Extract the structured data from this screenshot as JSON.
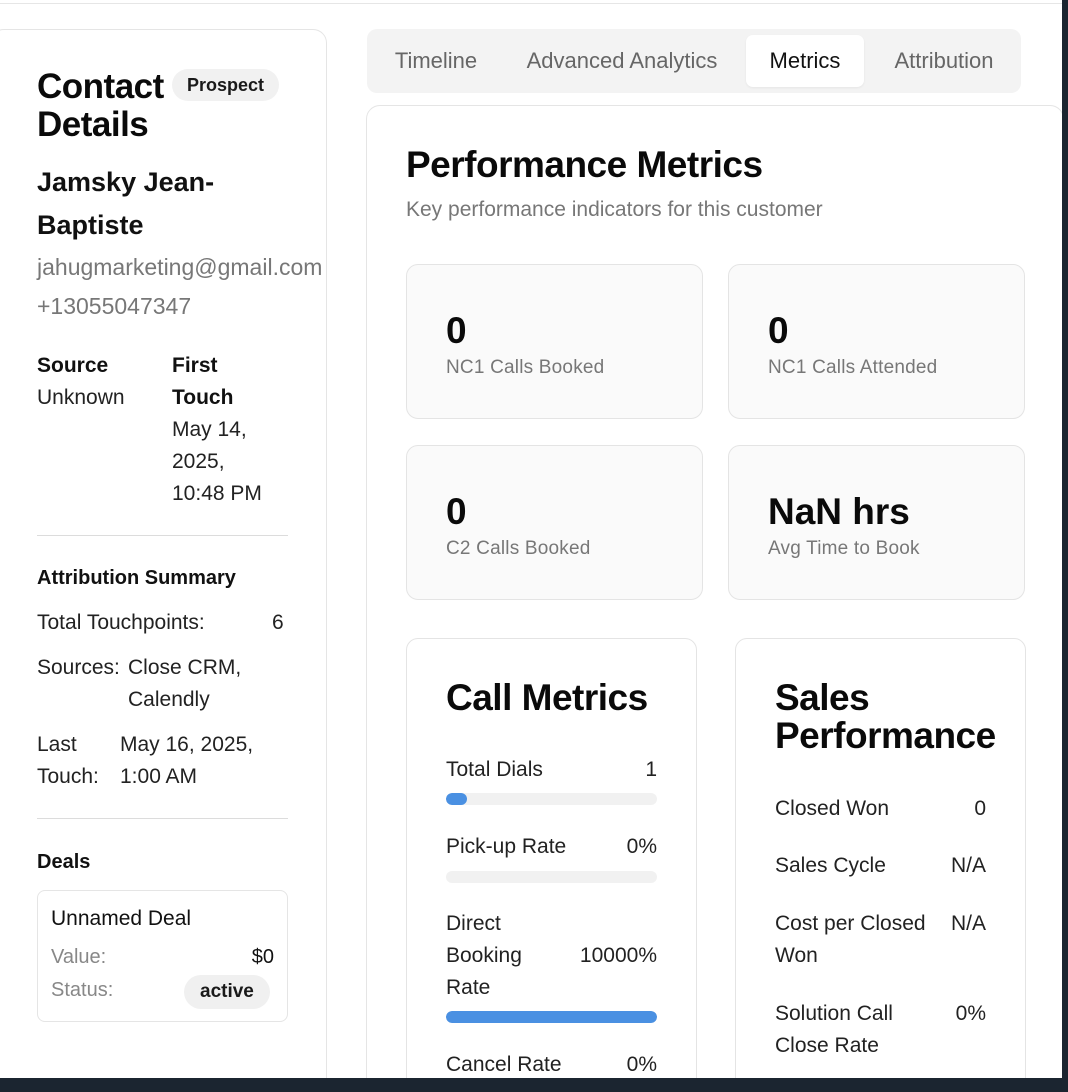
{
  "contact": {
    "title": "Contact Details",
    "badge": "Prospect",
    "name": "Jamsky Jean-Baptiste",
    "email": "jahugmarketing@gmail.com",
    "phone": "+13055047347",
    "source_label": "Source",
    "source_value": "Unknown",
    "first_touch_label": "First Touch",
    "first_touch_value": "May 14, 2025, 10:48 PM"
  },
  "attribution": {
    "heading": "Attribution Summary",
    "total_label": "Total Touchpoints:",
    "total_value": "6",
    "sources_label": "Sources:",
    "sources_value": "Close CRM, Calendly",
    "last_touch_label": "Last Touch:",
    "last_touch_value": "May 16, 2025, 1:00 AM"
  },
  "deals": {
    "heading": "Deals",
    "items": [
      {
        "name": "Unnamed Deal",
        "value_label": "Value:",
        "value": "$0",
        "status_label": "Status:",
        "status": "active"
      }
    ]
  },
  "tabs": [
    {
      "label": "Timeline",
      "active": false
    },
    {
      "label": "Advanced Analytics",
      "active": false
    },
    {
      "label": "Metrics",
      "active": true
    },
    {
      "label": "Attribution",
      "active": false
    }
  ],
  "performance": {
    "title": "Performance Metrics",
    "subtitle": "Key performance indicators for this customer",
    "kpis": [
      {
        "value": "0",
        "label": "NC1 Calls Booked"
      },
      {
        "value": "0",
        "label": "NC1 Calls Attended"
      },
      {
        "value": "0",
        "label": "C2 Calls Booked"
      },
      {
        "value": "NaN hrs",
        "label": "Avg Time to Book"
      }
    ]
  },
  "call_metrics": {
    "title": "Call Metrics",
    "items": [
      {
        "label": "Total Dials",
        "value": "1",
        "fill": 0.1
      },
      {
        "label": "Pick-up Rate",
        "value": "0%",
        "fill": 0
      },
      {
        "label": "Direct Booking Rate",
        "value": "10000%",
        "fill": 1
      },
      {
        "label": "Cancel Rate",
        "value": "0%",
        "fill": 0
      }
    ]
  },
  "sales_performance": {
    "title": "Sales Performance",
    "items": [
      {
        "label": "Closed Won",
        "value": "0"
      },
      {
        "label": "Sales Cycle",
        "value": "N/A"
      },
      {
        "label": "Cost per Closed Won",
        "value": "N/A"
      },
      {
        "label": "Solution Call Close Rate",
        "value": "0%"
      }
    ]
  },
  "colors": {
    "accent_bar": "#4a90e2",
    "window_frame": "#1b2530"
  }
}
